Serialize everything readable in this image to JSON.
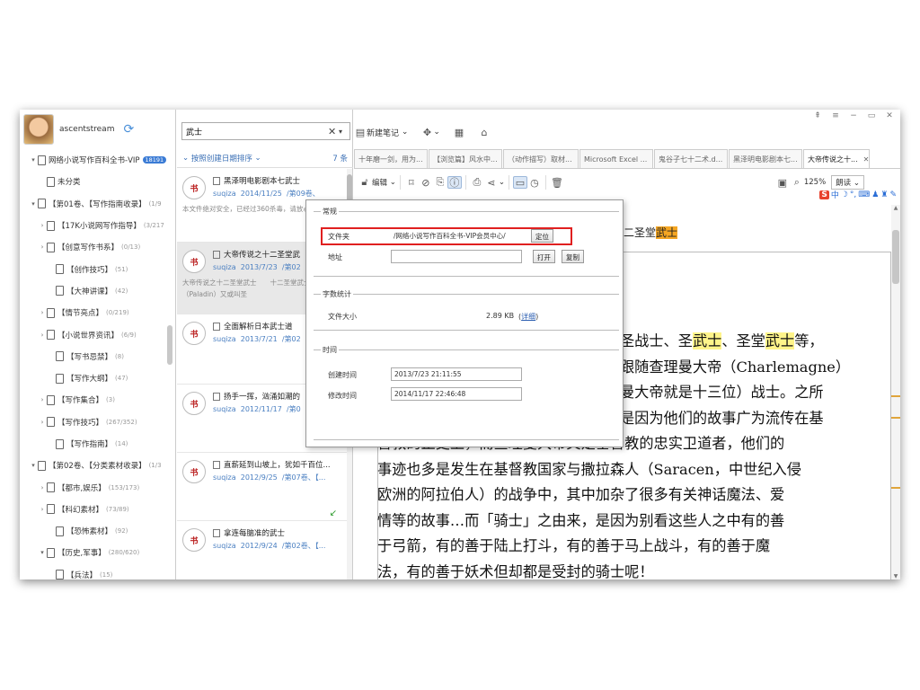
{
  "window_controls": [
    "⇞",
    "≡",
    "−",
    "▭",
    "✕"
  ],
  "user": {
    "name": "ascentstream"
  },
  "tree": [
    {
      "label": "网络小说写作百科全书-VIP",
      "badge": "18191",
      "count": "",
      "indent": 1,
      "arrow": "▾",
      "kind": "root"
    },
    {
      "label": "未分类",
      "count": "",
      "indent": 2,
      "arrow": ""
    },
    {
      "label": "【第01卷、【写作指南收录】",
      "count": "(1/9",
      "indent": 1,
      "arrow": "▾"
    },
    {
      "label": "【17K小说网写作指导】",
      "count": "(3/217",
      "indent": 2,
      "arrow": "›"
    },
    {
      "label": "【创意写作书系】",
      "count": "(0/13)",
      "indent": 2,
      "arrow": "›"
    },
    {
      "label": "【创作技巧】",
      "count": "(51)",
      "indent": 3,
      "arrow": ""
    },
    {
      "label": "【大神讲课】",
      "count": "(42)",
      "indent": 3,
      "arrow": ""
    },
    {
      "label": "【情节亮点】",
      "count": "(0/219)",
      "indent": 2,
      "arrow": "›"
    },
    {
      "label": "【小说世界资讯】",
      "count": "(6/9)",
      "indent": 2,
      "arrow": "›"
    },
    {
      "label": "【写书忌禁】",
      "count": "(8)",
      "indent": 3,
      "arrow": ""
    },
    {
      "label": "【写作大纲】",
      "count": "(47)",
      "indent": 3,
      "arrow": ""
    },
    {
      "label": "【写作集合】",
      "count": "(3)",
      "indent": 2,
      "arrow": "›"
    },
    {
      "label": "【写作技巧】",
      "count": "(267/352)",
      "indent": 2,
      "arrow": "›"
    },
    {
      "label": "【写作指南】",
      "count": "(14)",
      "indent": 3,
      "arrow": ""
    },
    {
      "label": "【第02卷、【分类素材收录】",
      "count": "(1/3",
      "indent": 1,
      "arrow": "▾"
    },
    {
      "label": "【都市,娱乐】",
      "count": "(153/173)",
      "indent": 2,
      "arrow": "›"
    },
    {
      "label": "【科幻素材】",
      "count": "(73/89)",
      "indent": 2,
      "arrow": "›"
    },
    {
      "label": "【恐怖素材】",
      "count": "(92)",
      "indent": 3,
      "arrow": ""
    },
    {
      "label": "【历史,军事】",
      "count": "(280/620)",
      "indent": 2,
      "arrow": "▾"
    },
    {
      "label": "【兵法】",
      "count": "(15)",
      "indent": 3,
      "arrow": ""
    }
  ],
  "search": {
    "value": "武士"
  },
  "sort": {
    "label": "按照创建日期排序",
    "count": "7 条"
  },
  "notes": [
    {
      "title": "黑泽明电影剧本七武士",
      "author": "suqiza",
      "date": "2014/11/25",
      "folder": "/第09卷、",
      "summary": "本文件绝对安全，已经过360杀毒，请放心使用。",
      "logo": "书"
    },
    {
      "title": "大帝传说之十二圣堂武",
      "author": "suqiza",
      "date": "2013/7/23",
      "folder": "/第02",
      "summary": "大帝传说之十二圣堂武士　　十二圣堂武士（Paladin）又或叫圣",
      "logo": "书"
    },
    {
      "title": "全面解析日本武士道",
      "author": "suqiza",
      "date": "2013/7/21",
      "folder": "/第02",
      "summary": "",
      "logo": "书"
    },
    {
      "title": "扬手一挥，汹涌如潮的",
      "author": "suqiza",
      "date": "2012/11/17",
      "folder": "/第0",
      "summary": "",
      "logo": "书"
    },
    {
      "title": "直薪延到山坡上，犹如千百位...",
      "author": "suqiza",
      "date": "2012/9/25",
      "folder": "/第07卷、【...",
      "summary": "",
      "logo": "书"
    },
    {
      "title": "拿连每脑准的武士",
      "author": "suqiza",
      "date": "2012/9/24",
      "folder": "/第02卷、【...",
      "summary": "",
      "logo": "书"
    }
  ],
  "toolbar": {
    "new_note": "新建笔记",
    "edit": "编辑"
  },
  "tabs": [
    {
      "label": "十年磨一剑，用为..."
    },
    {
      "label": "【浏览篇】风水中..."
    },
    {
      "label": "（动作描写）取材..."
    },
    {
      "label": "Microsoft Excel ..."
    },
    {
      "label": "鬼谷子七十二术.d..."
    },
    {
      "label": "黑泽明电影剧本七..."
    },
    {
      "label": "大帝传说之十...",
      "active": true
    }
  ],
  "zoom": {
    "level": "125%",
    "read": "朗读"
  },
  "document": {
    "title_prefix": "二圣堂",
    "title_hl": "武士",
    "lines": [
      {
        "parts": [
          {
            "t": "圣战士、圣"
          },
          {
            "t": "武士",
            "hl": true
          },
          {
            "t": "、圣堂"
          },
          {
            "t": "武士",
            "hl": true
          },
          {
            "t": "等，"
          }
        ],
        "offset": 270
      },
      {
        "parts": [
          {
            "t": "跟随查理曼大帝（Charlemagne）"
          }
        ],
        "offset": 270
      },
      {
        "parts": [
          {
            "t": "曼大帝就是十三位）战士。之所"
          }
        ],
        "offset": 270
      },
      {
        "parts": [
          {
            "t": "是因为他们的故事广为流传在基"
          }
        ],
        "offset": 270
      },
      {
        "parts": [
          {
            "t": "督教的正史上，而查理曼大帝又是基督教的忠实卫道者，他们的"
          }
        ],
        "offset": 0
      },
      {
        "parts": [
          {
            "t": "事迹也多是发生在基督教国家与撒拉森人（Saracen，中世纪入侵"
          }
        ],
        "offset": 0
      },
      {
        "parts": [
          {
            "t": "欧洲的阿拉伯人）的战争中，其中加杂了很多有关神话魔法、爱"
          }
        ],
        "offset": 0
      },
      {
        "parts": [
          {
            "t": "情等的故事…而「骑士」之由来，是因为别看这些人之中有的善"
          }
        ],
        "offset": 0
      },
      {
        "parts": [
          {
            "t": "于弓箭，有的善于陆上打斗，有的善于马上战斗，有的善于魔"
          }
        ],
        "offset": 0
      },
      {
        "parts": [
          {
            "t": "法，有的善于妖术但却都是受封的骑士呢！"
          }
        ],
        "offset": 0
      }
    ]
  },
  "popup": {
    "section_general": "常规",
    "label_folder": "文件夹",
    "folder_value": "/网络小说写作百科全书-VIP会员中心/",
    "btn_locate": "定位",
    "label_address": "地址",
    "address_value": "",
    "btn_open": "打开",
    "btn_copy": "复制",
    "section_stats": "字数统计",
    "label_size": "文件大小",
    "size_value": "2.89 KB",
    "detail_link": "详细",
    "section_time": "时间",
    "label_created": "创建时间",
    "created_value": "2013/7/23 21:11:55",
    "label_modified": "修改时间",
    "modified_value": "2014/11/17 22:46:48"
  },
  "colors": {
    "accent": "#3a7bd5",
    "highlight_yellow": "#fff48a",
    "highlight_orange": "#f5a623",
    "red_box": "#e02020"
  }
}
